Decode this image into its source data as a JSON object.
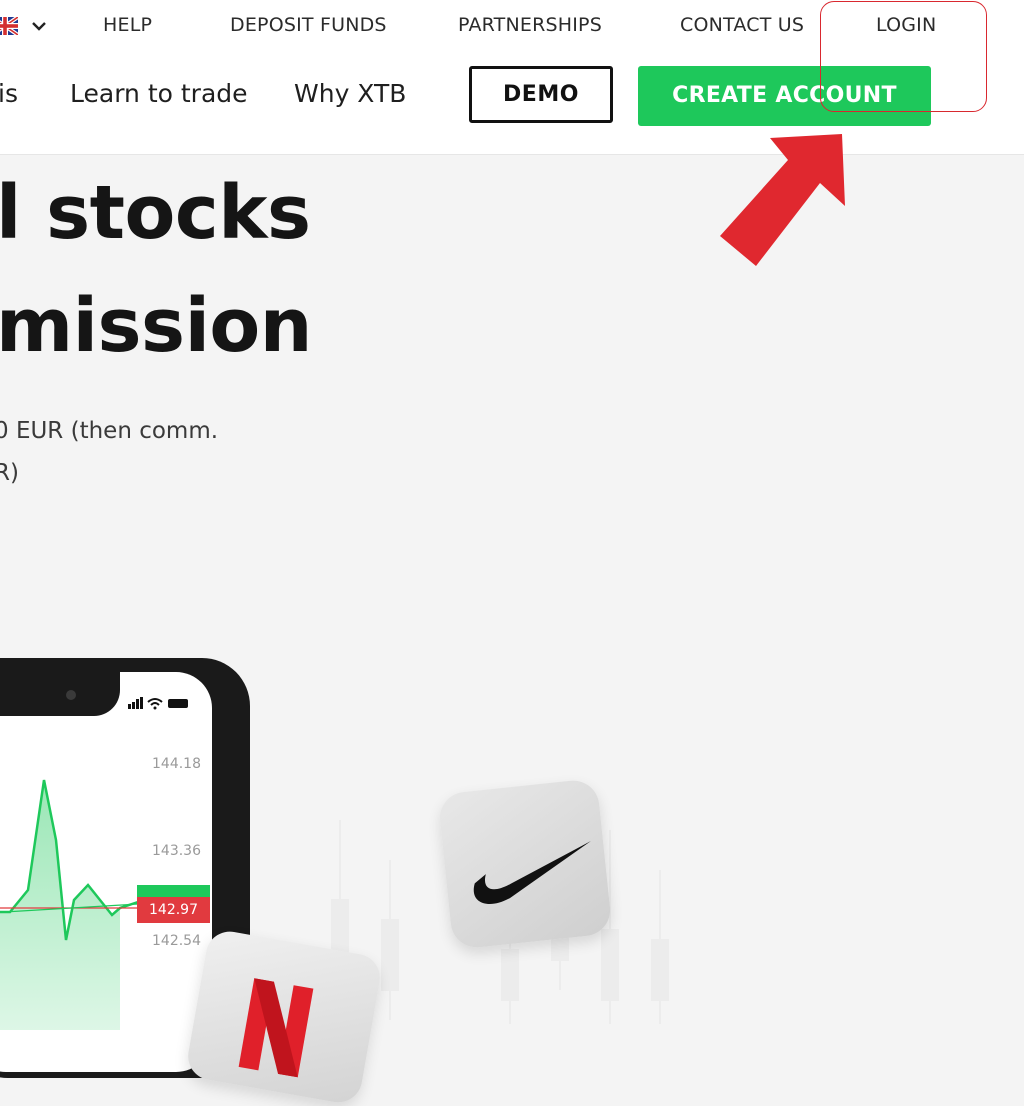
{
  "topbar": {
    "language_flag": "uk-flag-icon",
    "language_chevron": "chevron-down-icon",
    "links": {
      "help": "HELP",
      "deposit": "DEPOSIT FUNDS",
      "partnerships": "PARTNERSHIPS",
      "contact": "CONTACT US",
      "login": "LOGIN"
    }
  },
  "nav": {
    "item_partial": "is",
    "learn": "Learn to trade",
    "why": "Why XTB",
    "demo_button": "DEMO",
    "create_button": "CREATE ACCOUNT"
  },
  "hero": {
    "line1": "l stocks",
    "line2": "mission",
    "sub1": "0 EUR (then comm.",
    "sub2": "R)"
  },
  "phone": {
    "status_icons": "signal-wifi-battery-icon",
    "prices": [
      "144.18",
      "143.36",
      "142.97",
      "142.54"
    ],
    "current_price": "142.97"
  },
  "annotations": {
    "arrow": "red-arrow-icon",
    "highlight": "login-highlight-box"
  },
  "tiles": {
    "nike": "nike-swoosh-icon",
    "red": "red-logo-icon"
  },
  "colors": {
    "accent_green": "#1ec85b",
    "annotation_red": "#d9282f",
    "price_red": "#e13a3f"
  }
}
